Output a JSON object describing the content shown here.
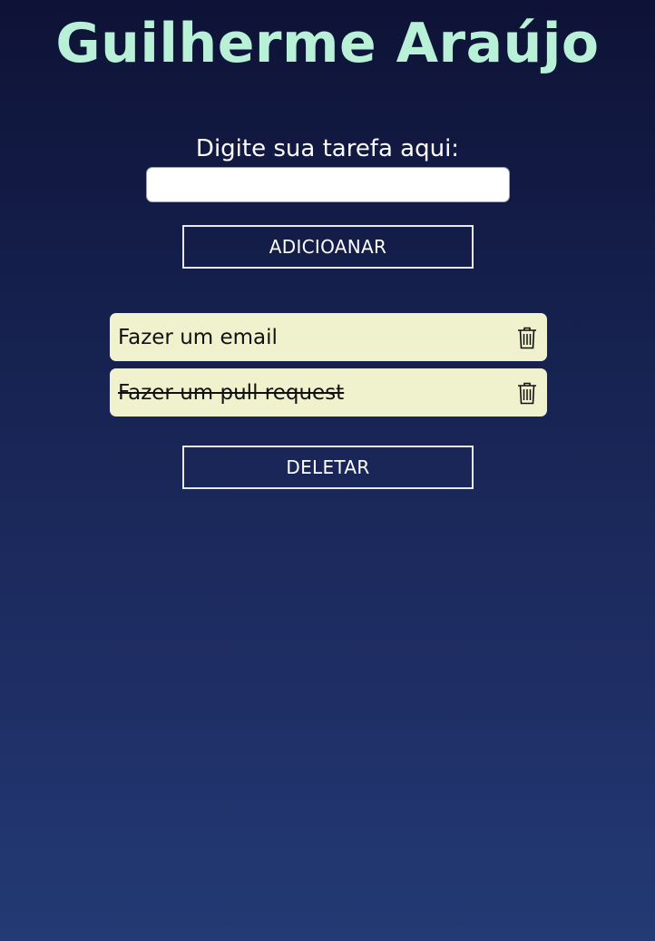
{
  "header": {
    "title": "Guilherme Araújo",
    "title_color": "#b8f0d8"
  },
  "form": {
    "label": "Digite sua tarefa aqui:",
    "input_value": "",
    "input_placeholder": "",
    "add_button_label": "ADICIOANAR"
  },
  "tasks": [
    {
      "text": "Fazer um email",
      "completed": false,
      "icon": "trash-icon"
    },
    {
      "text": "Fazer um pull request",
      "completed": true,
      "icon": "trash-icon"
    }
  ],
  "actions": {
    "delete_button_label": "DELETAR"
  },
  "colors": {
    "task_background": "#f0f2ce",
    "background_top": "#0e1236",
    "background_bottom": "#233a74"
  }
}
